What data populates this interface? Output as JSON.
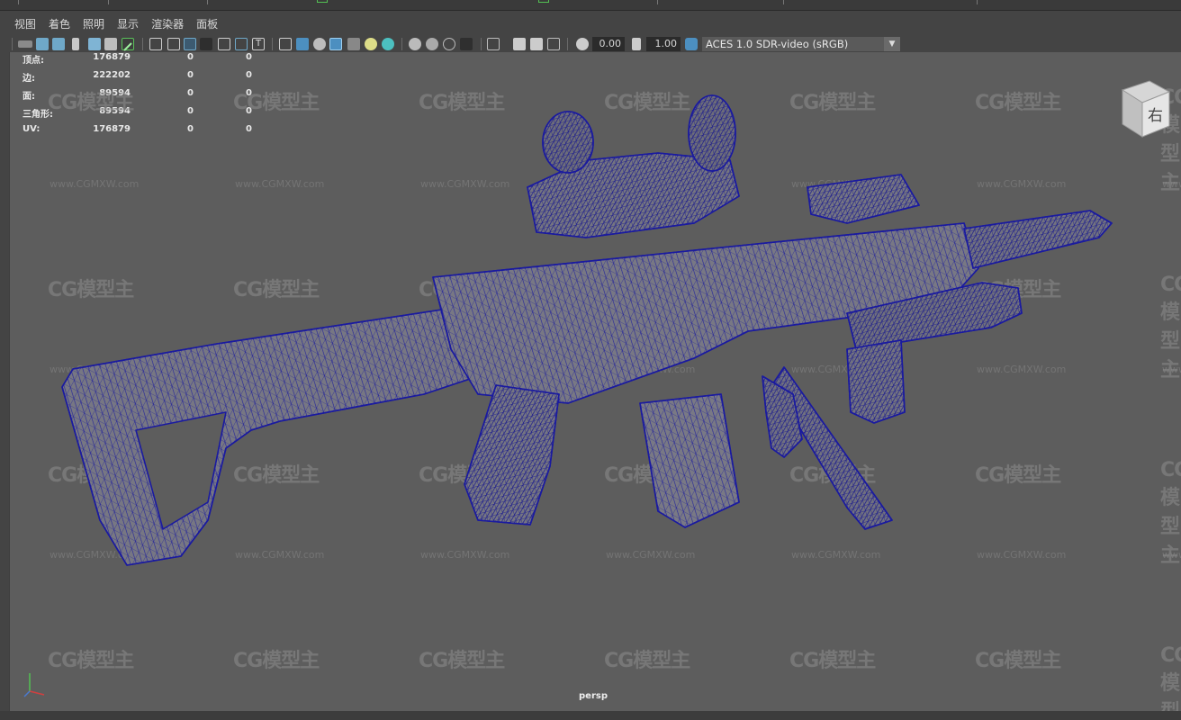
{
  "menu": [
    "视图",
    "着色",
    "照明",
    "显示",
    "渲染器",
    "面板"
  ],
  "toolbar": {
    "exposure_value": "0.00",
    "gamma_value": "1.00",
    "color_space": "ACES 1.0 SDR-video (sRGB)"
  },
  "hud": {
    "rows": [
      {
        "label": "顶点:",
        "v1": "176879",
        "v2": "0",
        "v3": "0"
      },
      {
        "label": "边:",
        "v1": "222202",
        "v2": "0",
        "v3": "0"
      },
      {
        "label": "面:",
        "v1": "89594",
        "v2": "0",
        "v3": "0"
      },
      {
        "label": "三角形:",
        "v1": "89594",
        "v2": "0",
        "v3": "0"
      },
      {
        "label": "UV:",
        "v1": "176879",
        "v2": "0",
        "v3": "0"
      }
    ]
  },
  "viewcube": {
    "face_label": "右"
  },
  "camera_label": "persp",
  "watermark": {
    "logo": "CG模型主",
    "url": "www.CGMXW.com"
  },
  "colors": {
    "viewport_bg": "#5d5d5d",
    "wire": "#1a1aa0",
    "mesh_fill": "#777783"
  }
}
